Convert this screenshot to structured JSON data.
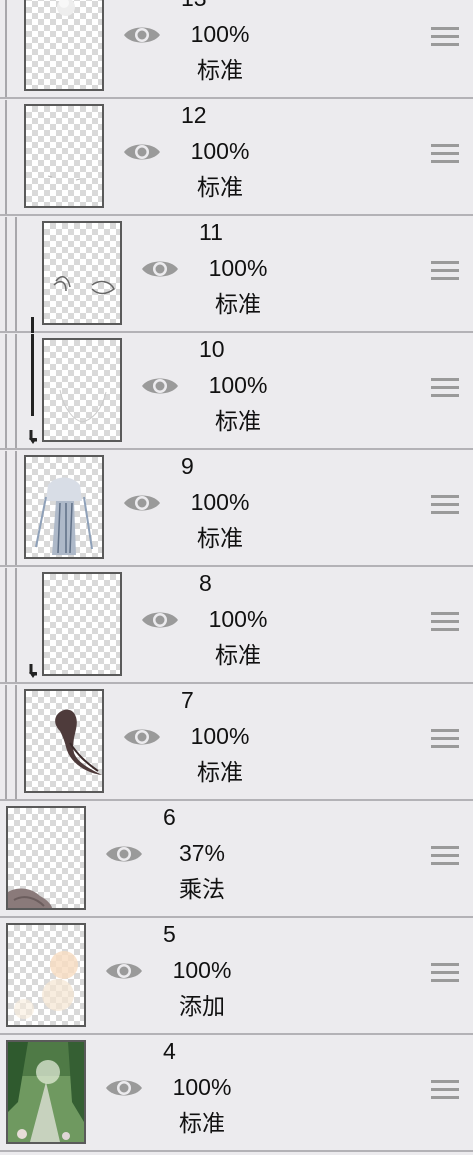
{
  "layers": [
    {
      "number": "13",
      "opacity": "100%",
      "blend": "标准",
      "thumb_art": "white-blob",
      "clip": false,
      "clip_end": false
    },
    {
      "number": "12",
      "opacity": "100%",
      "blend": "标准",
      "thumb_art": "faint-marks",
      "clip": false,
      "clip_end": false
    },
    {
      "number": "11",
      "opacity": "100%",
      "blend": "标准",
      "thumb_art": "eye-sketch",
      "clip": true,
      "clip_end": false
    },
    {
      "number": "10",
      "opacity": "100%",
      "blend": "标准",
      "thumb_art": "face-outline",
      "clip": true,
      "clip_end": true
    },
    {
      "number": "9",
      "opacity": "100%",
      "blend": "标准",
      "thumb_art": "character",
      "clip": false,
      "clip_end": false
    },
    {
      "number": "8",
      "opacity": "100%",
      "blend": "标准",
      "thumb_art": "empty",
      "clip": true,
      "clip_end": true
    },
    {
      "number": "7",
      "opacity": "100%",
      "blend": "标准",
      "thumb_art": "hair",
      "clip": false,
      "clip_end": false
    },
    {
      "number": "6",
      "opacity": "37%",
      "blend": "乘法",
      "thumb_art": "shadow",
      "clip": false,
      "clip_end": false
    },
    {
      "number": "5",
      "opacity": "100%",
      "blend": "添加",
      "thumb_art": "glow",
      "clip": false,
      "clip_end": false
    },
    {
      "number": "4",
      "opacity": "100%",
      "blend": "标准",
      "thumb_art": "forest",
      "clip": false,
      "clip_end": false
    }
  ],
  "icons": {
    "visibility": "eye-icon",
    "reorder": "drag-handle-icon",
    "clipping": "clipping-arrow-icon"
  },
  "colors": {
    "row_background": "#ecebee",
    "divider": "#b3b2b6",
    "eye_icon": "#9a9a9a",
    "clip_arrow": "#222222"
  }
}
